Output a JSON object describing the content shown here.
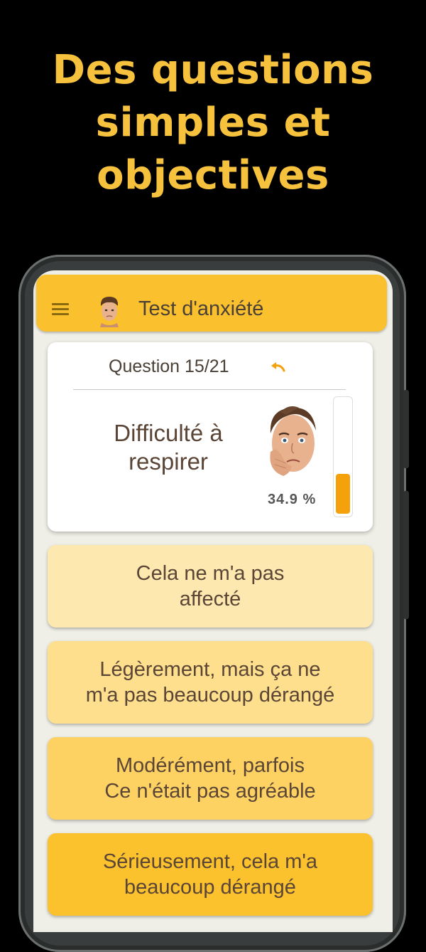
{
  "headline": {
    "lines": [
      "Des questions",
      "simples et",
      "objectives"
    ]
  },
  "app": {
    "title": "Test d'anxiété"
  },
  "question": {
    "counter": "Question 15/21",
    "text_lines": [
      "Difficulté à",
      "respirer"
    ],
    "percent_label": "34.9 %",
    "level_fraction": 0.349
  },
  "answers": [
    {
      "lines": [
        "Cela ne m'a pas",
        "affecté"
      ]
    },
    {
      "lines": [
        "Légèrement, mais ça ne",
        "m'a pas beaucoup dérangé"
      ]
    },
    {
      "lines": [
        "Modérément, parfois",
        "Ce n'était pas agréable"
      ]
    },
    {
      "lines": [
        "Sérieusement, cela m'a",
        "beaucoup dérangé"
      ]
    }
  ],
  "colors": {
    "accent": "#fbc02d",
    "headline": "#f6c23e",
    "gauge_fill": "#f5a10c"
  },
  "icons": [
    "menu-icon",
    "avatar",
    "undo-icon",
    "anxious-face-illustration"
  ]
}
